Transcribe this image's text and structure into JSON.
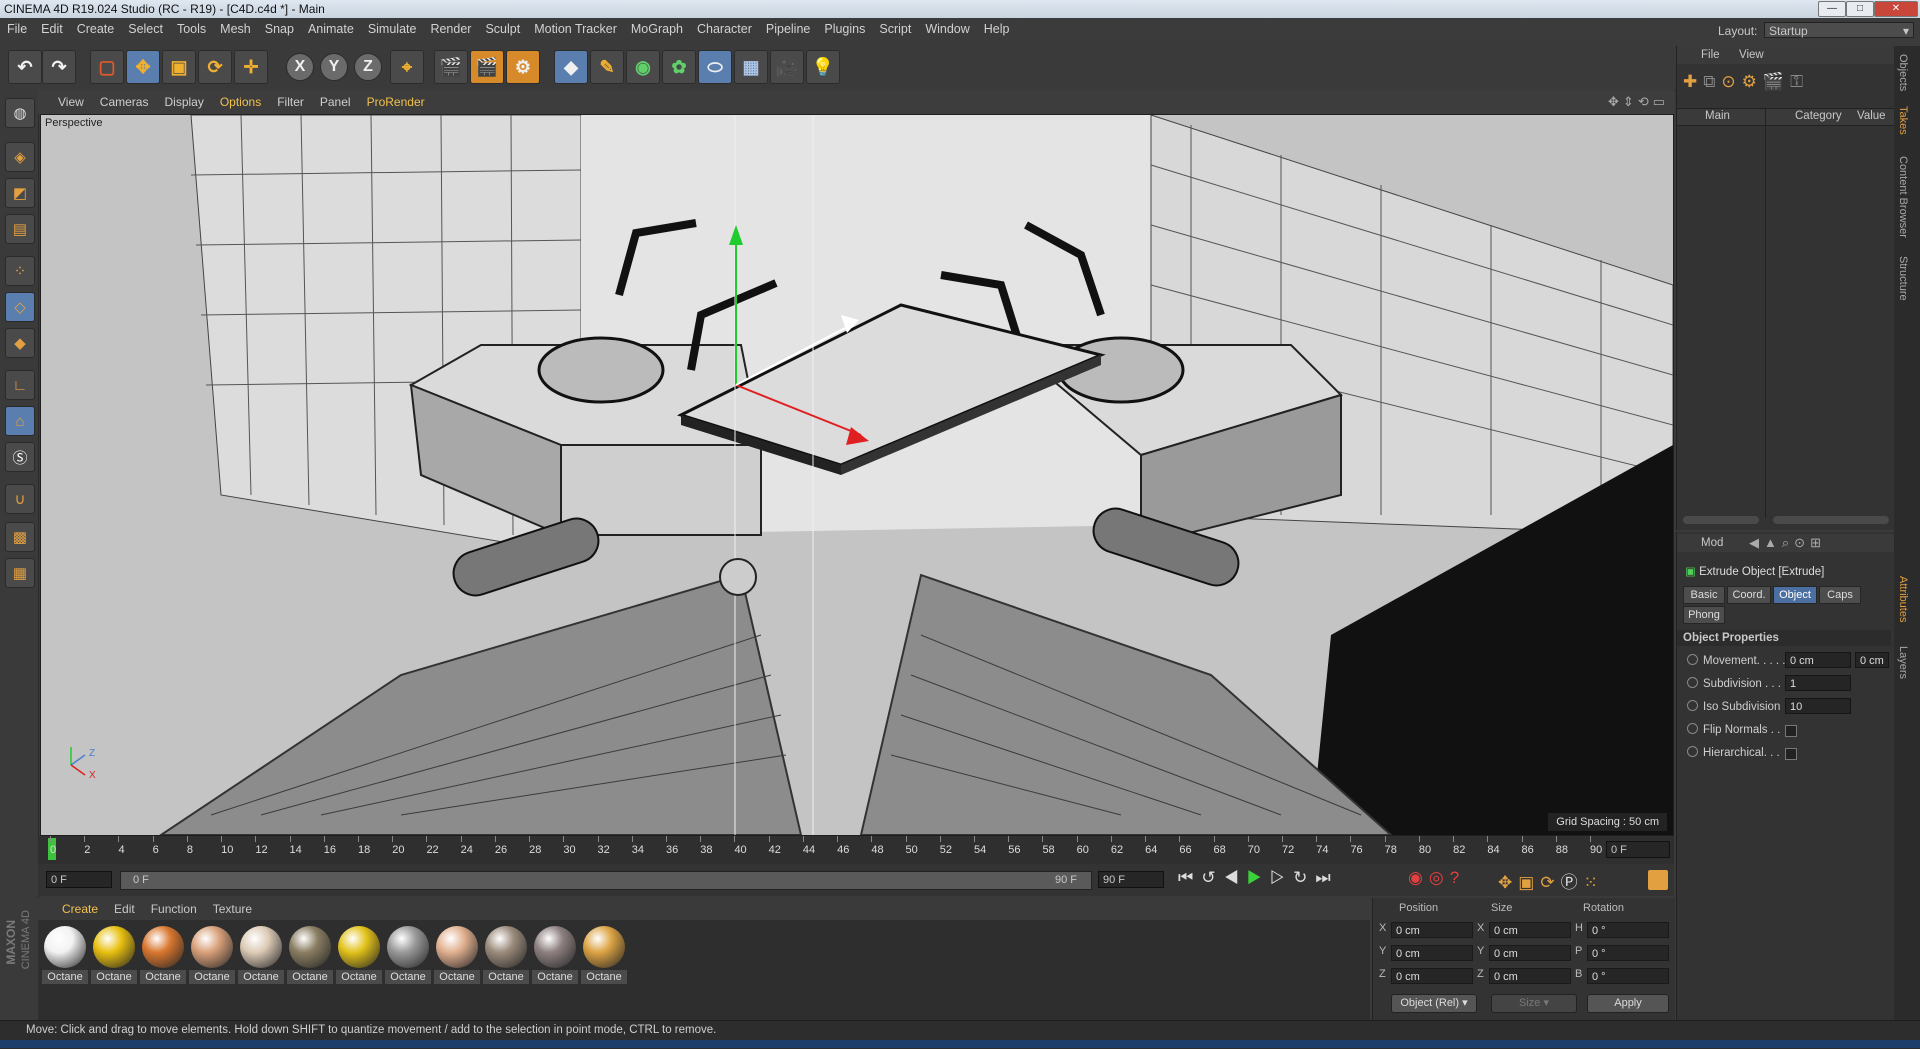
{
  "window": {
    "title": "CINEMA 4D R19.024 Studio (RC - R19) - [C4D.c4d *] - Main",
    "buttons": [
      "—",
      "□",
      "✕"
    ]
  },
  "menu": [
    "File",
    "Edit",
    "Create",
    "Select",
    "Tools",
    "Mesh",
    "Snap",
    "Animate",
    "Simulate",
    "Render",
    "Sculpt",
    "Motion Tracker",
    "MoGraph",
    "Character",
    "Pipeline",
    "Plugins",
    "Script",
    "Window",
    "Help"
  ],
  "layout": {
    "label": "Layout:",
    "value": "Startup"
  },
  "toolbar": {
    "axis_x": "X",
    "axis_y": "Y",
    "axis_z": "Z"
  },
  "viewport": {
    "menu": [
      "View",
      "Cameras",
      "Display",
      "Options",
      "Filter",
      "Panel",
      "ProRender"
    ],
    "label": "Perspective",
    "grid_spacing": "Grid Spacing : 50 cm"
  },
  "timeline": {
    "ticks": [
      "0",
      "2",
      "4",
      "6",
      "8",
      "10",
      "12",
      "14",
      "16",
      "18",
      "20",
      "22",
      "24",
      "26",
      "28",
      "30",
      "32",
      "34",
      "36",
      "38",
      "40",
      "42",
      "44",
      "46",
      "48",
      "50",
      "52",
      "54",
      "56",
      "58",
      "60",
      "62",
      "64",
      "66",
      "68",
      "70",
      "72",
      "74",
      "76",
      "78",
      "80",
      "82",
      "84",
      "86",
      "88",
      "90"
    ],
    "current_frame": "0 F",
    "start_field": "0 F",
    "range_start": "0 F",
    "range_end": "90 F",
    "end_field": "90 F"
  },
  "materials": {
    "menu": [
      "Create",
      "Edit",
      "Function",
      "Texture"
    ],
    "items": [
      {
        "label": "Octane",
        "color": "#f2f2f2"
      },
      {
        "label": "Octane",
        "color": "#e8c010"
      },
      {
        "label": "Octane",
        "color": "#d9772f"
      },
      {
        "label": "Octane",
        "color": "#d9a07a"
      },
      {
        "label": "Octane",
        "color": "#dccbb6"
      },
      {
        "label": "Octane",
        "color": "#8a7e62"
      },
      {
        "label": "Octane",
        "color": "#e2c21a"
      },
      {
        "label": "Octane",
        "color": "#9a9a9a"
      },
      {
        "label": "Octane",
        "color": "#e1b08f"
      },
      {
        "label": "Octane",
        "color": "#9b8b7c"
      },
      {
        "label": "Octane",
        "color": "#8e8080"
      },
      {
        "label": "Octane",
        "color": "#dca344"
      }
    ]
  },
  "coords": {
    "headers": [
      "Position",
      "Size",
      "Rotation"
    ],
    "rows": [
      {
        "axis": "X",
        "pos": "0 cm",
        "saxis": "X",
        "size": "0 cm",
        "raxis": "H",
        "rot": "0 °"
      },
      {
        "axis": "Y",
        "pos": "0 cm",
        "saxis": "Y",
        "size": "0 cm",
        "raxis": "P",
        "rot": "0 °"
      },
      {
        "axis": "Z",
        "pos": "0 cm",
        "saxis": "Z",
        "size": "0 cm",
        "raxis": "B",
        "rot": "0 °"
      }
    ],
    "mode": "Object (Rel)",
    "size_mode": "Size",
    "apply": "Apply"
  },
  "objects": {
    "menu": [
      "File",
      "View"
    ],
    "columns": [
      "Main",
      "Category",
      "Value"
    ]
  },
  "attributes": {
    "mode": "Mod",
    "object": "Extrude Object [Extrude]",
    "tabs": [
      "Basic",
      "Coord.",
      "Object",
      "Caps",
      "Phong"
    ],
    "section": "Object Properties",
    "props": [
      {
        "label": "Movement. . . . .",
        "v1": "0 cm",
        "v2": "0 cm"
      },
      {
        "label": "Subdivision . . .",
        "v1": "1"
      },
      {
        "label": "Iso Subdivision",
        "v1": "10"
      },
      {
        "label": "Flip Normals . ."
      },
      {
        "label": "Hierarchical. . ."
      }
    ]
  },
  "sidetabs": [
    "Objects",
    "Takes",
    "Content Browser",
    "Structure",
    "Attributes",
    "Layers"
  ],
  "status": "Move: Click and drag to move elements. Hold down SHIFT to quantize movement / add to the selection in point mode, CTRL to remove.",
  "brand": [
    "MAXON",
    "CINEMA 4D"
  ]
}
